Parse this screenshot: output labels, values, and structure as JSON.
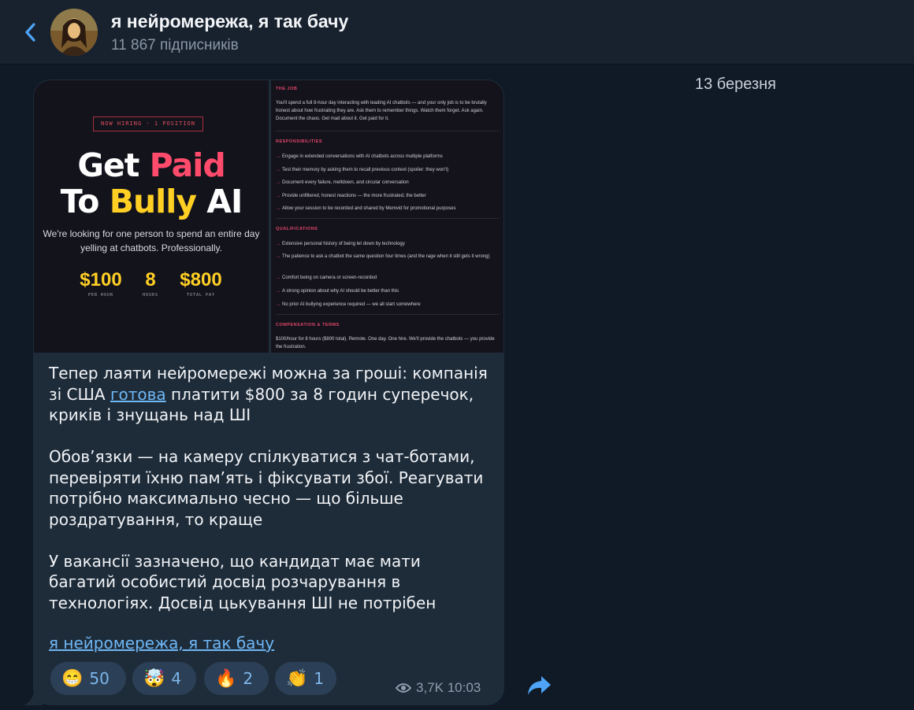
{
  "header": {
    "title": "я нейромережа, я так бачу",
    "subscribers": "11 867 підписників"
  },
  "date": "13 березня",
  "post": {
    "image_left": {
      "hiring": "NOW HIRING · 1 POSITION",
      "headline_1a": "Get ",
      "headline_1b": "Paid",
      "headline_2a": "To ",
      "headline_2b": "Bully",
      "headline_2c": " AI",
      "tagline": "We're looking for one person to spend an entire day yelling at chatbots. Professionally.",
      "stats": [
        {
          "value": "$100",
          "label": "PER HOUR"
        },
        {
          "value": "8",
          "label": "HOURS"
        },
        {
          "value": "$800",
          "label": "TOTAL PAY"
        }
      ]
    },
    "image_right": {
      "job_head": "THE JOB",
      "job_text": "You'll spend a full 8-hour day interacting with leading AI chatbots — and your only job is to be brutally honest about how frustrating they are. Ask them to remember things. Watch them forget. Ask again. Document the chaos. Get mad about it. Get paid for it.",
      "resp_head": "RESPONSIBILITIES",
      "responsibilities": [
        "Engage in extended conversations with AI chatbots across multiple platforms",
        "Test their memory by asking them to recall previous context (spoiler: they won't)",
        "Document every failure, meltdown, and circular conversation",
        "Provide unfiltered, honest reactions — the more frustrated, the better",
        "Allow your session to be recorded and shared by Memvid for promotional purposes"
      ],
      "qual_head": "QUALIFICATIONS",
      "qualifications": [
        "Extensive personal history of being let down by technology",
        "The patience to ask a chatbot the same question four times (and the rage when it still gets it wrong)",
        "Comfort being on camera or screen-recorded",
        "A strong opinion about why AI should be better than this",
        "No prior AI bullying experience required — we all start somewhere"
      ],
      "comp_head": "COMPENSATION & TERMS",
      "comp_text": "$100/hour for 8 hours ($800 total). Remote. One day. One hire. We'll provide the chatbots — you provide the frustration."
    },
    "text": {
      "p1_before": "Тепер лаяти нейромережі можна за гроші: компанія зі США ",
      "p1_link": "готова",
      "p1_after": " платити $800 за 8 годин суперечок, криків і знущань над ШІ",
      "p2": "Обов’язки — на камеру спілкуватися з чат-ботами, перевіряти їхню пам’ять і фіксувати збої. Реагувати потрібно максимально чесно — що більше роздратування, то краще",
      "p3": "У вакансії зазначено, що кандидат має мати багатий особистий досвід розчарування в технологіях. Досвід цькування ШІ не потрібен"
    },
    "signature": "я нейромережа, я так бачу",
    "reactions": [
      {
        "emoji": "😁",
        "count": "50"
      },
      {
        "emoji": "🤯",
        "count": "4"
      },
      {
        "emoji": "🔥",
        "count": "2"
      },
      {
        "emoji": "👏",
        "count": "1"
      }
    ],
    "views": "3,7K",
    "time": "10:03"
  },
  "colors": {
    "accent_link": "#6fb7f5",
    "bubble": "#1e2c3a",
    "reaction_bg": "#2b4056",
    "headline_pink": "#ff4b6b",
    "headline_yellow": "#ffcf24"
  }
}
